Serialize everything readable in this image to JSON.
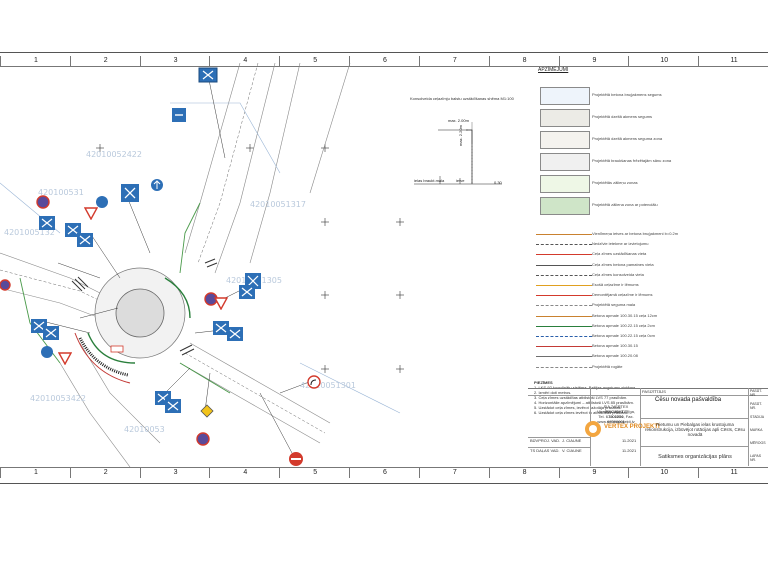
{
  "grid_top_labels": [
    "1",
    "2",
    "3",
    "4",
    "5",
    "6",
    "7",
    "8",
    "9",
    "10",
    "11"
  ],
  "grid_bottom_labels": [
    "1",
    "2",
    "3",
    "4",
    "5",
    "6",
    "7",
    "8",
    "9",
    "10",
    "11"
  ],
  "legend_title": "APZĪMĒJUMI",
  "legend_fills": [
    {
      "label": "Projektētā betona bruģakmens segums",
      "color": "#eef4fb"
    },
    {
      "label": "Projektētā dzeltā akmens segums",
      "color": "#ecebe6"
    },
    {
      "label": "Projektētā dzeltā akmens seguma zona",
      "color": "#f4f2ee"
    },
    {
      "label": "Projektētā braukšanas frēzētajām sānu zona",
      "color": "#f0f0f0"
    },
    {
      "label": "Projektētās zālieņu zonas",
      "color": "#eef7e6"
    },
    {
      "label": "Projektētā zāliena zona ar potenciālu",
      "color": "#cfe5c8"
    }
  ],
  "legend_lines": [
    {
      "label": "Vienlīmeņa ietves ar betona bruģakmeni b=0.2m",
      "color": "#c9812f"
    },
    {
      "label": "Nedzīvie ietekme ar izvietojumu",
      "color": "#555555"
    },
    {
      "label": "Ceļa zīmes uzstādīšanas vieta",
      "color": "#d33a2c"
    },
    {
      "label": "Ceļa zīmes betona pamatnes vieta",
      "color": "#555555"
    },
    {
      "label": "Ceļa zīmes konsolveida vieta",
      "color": "#555555"
    },
    {
      "label": "Esošā ceļazīme ir lēmums",
      "color": "#e0a020"
    },
    {
      "label": "Demontējamā ceļazīme ir lēmums",
      "color": "#d33a2c"
    },
    {
      "label": "Projektētā seguma mala",
      "color": "#888888"
    },
    {
      "label": "Betona apmale 100.30.15 ceļa 12cm",
      "color": "#c9812f"
    },
    {
      "label": "Betona apmale 100.22.15 ceļa 2cm",
      "color": "#2a7f3c"
    },
    {
      "label": "Betona apmale 100.22.15 ceļa 0cm",
      "color": "#2a5faa"
    },
    {
      "label": "Betona apmale 100.30.15",
      "color": "#c33a36"
    },
    {
      "label": "Betona apmale 100.20.08",
      "color": "#6e6e6e"
    },
    {
      "label": "Projektētā rogāte",
      "color": "#888888"
    }
  ],
  "notes_title": "PIEZĪMES",
  "notes": [
    "1. LKS-92 koordinātu sistēma. Baltijas augstumu sistēma",
    "2. Izmēri doti metros.",
    "3. Ceļa zīmes uzstādītas atbilstoši LVS 77 prasībām.",
    "4. Horizontālie apzīmējumi – atbilstoši LVS 85 prasībām.",
    "5. Uzstādot ceļa zīmes, ievērot ražotāja prasības.",
    "6. Uzstādot ceļa zīmes ievērot to atbilstības prasības."
  ],
  "detail": {
    "title": "Konsolveida ceļazīmju balstu uzstādīšanas shēma M1:100",
    "dim_top": "max. 2.00m",
    "dim_side": "max. 2.20m",
    "left_label": "ielas braukt.mala",
    "mid_label": "ietve",
    "right_label": "0.30"
  },
  "cad_ids": [
    {
      "text": "42010052422"
    },
    {
      "text": "42010051317"
    },
    {
      "text": "420100531"
    },
    {
      "text": "4201005132"
    },
    {
      "text": "42010051305"
    },
    {
      "text": "42010051301"
    },
    {
      "text": "42010053422"
    },
    {
      "text": "42010053"
    }
  ],
  "title_block": {
    "company_name": "SIA \"VERTEX PROJEKTI\"",
    "company_addr": "Vienības iela 1, Rīga, LV-1234",
    "company_tel": "Tel. 67000000, Fax. 67000001",
    "company_web": "www.vertexprojekti.lv",
    "logo_text": "VERTEX PROJEKTI",
    "client_label": "PASŪTĪTĀJS",
    "client": "Cēsu novada pašvaldība",
    "project": "Rietumu un Piebalgas ielas krustojuma rekonstrukcija, izbūvējot rotācijas apli Cēsīs, Cēsu novadā",
    "sheet_title": "Satiksmes organizācijas plāns",
    "role1": "BŪVPROJ. VAD.",
    "name1": "J. CIAUNE",
    "date1": "11.2021",
    "role2": "TS DAĻAS VAD.",
    "name2": "V. CIAUNE",
    "date2": "11.2021",
    "right_labels": [
      "PASŪT. NR.",
      "PASŪT. NR.",
      "STADIJA",
      "MARKA",
      "MĒROGS",
      "LAPAS NR."
    ]
  }
}
